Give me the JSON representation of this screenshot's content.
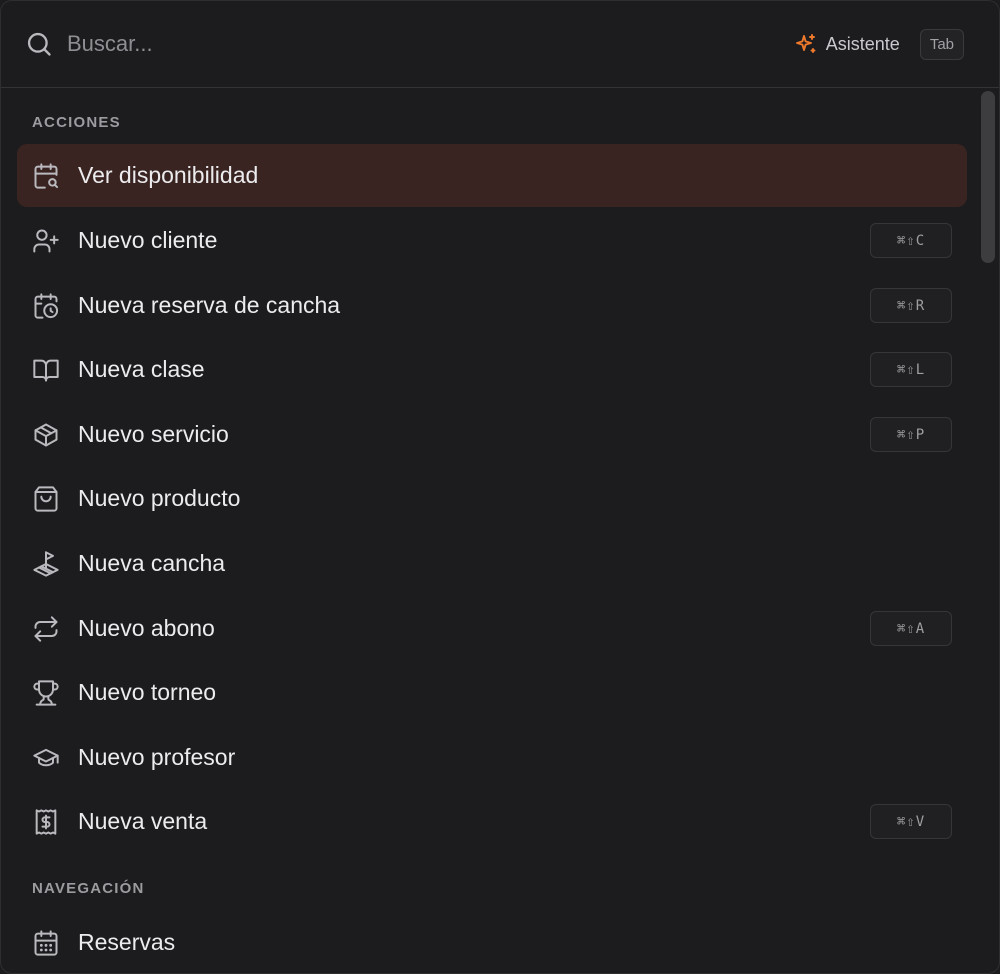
{
  "search": {
    "placeholder": "Buscar...",
    "icon": "search-icon"
  },
  "assistant": {
    "label": "Asistente",
    "icon": "sparkles-icon",
    "accent_color": "#f07a2c",
    "tab_key": "Tab"
  },
  "sections": {
    "actions_title": "ACCIONES",
    "navigation_title": "NAVEGACIÓN"
  },
  "actions": [
    {
      "label": "Ver disponibilidad",
      "icon": "calendar-search-icon",
      "shortcut": "",
      "active": true
    },
    {
      "label": "Nuevo cliente",
      "icon": "user-plus-icon",
      "shortcut": "⌘⇧C"
    },
    {
      "label": "Nueva reserva de cancha",
      "icon": "calendar-clock-icon",
      "shortcut": "⌘⇧R"
    },
    {
      "label": "Nueva clase",
      "icon": "book-open-icon",
      "shortcut": "⌘⇧L"
    },
    {
      "label": "Nuevo servicio",
      "icon": "package-icon",
      "shortcut": "⌘⇧P"
    },
    {
      "label": "Nuevo producto",
      "icon": "shopping-bag-icon",
      "shortcut": ""
    },
    {
      "label": "Nueva cancha",
      "icon": "land-plot-icon",
      "shortcut": ""
    },
    {
      "label": "Nuevo abono",
      "icon": "repeat-icon",
      "shortcut": "⌘⇧A"
    },
    {
      "label": "Nuevo torneo",
      "icon": "trophy-icon",
      "shortcut": ""
    },
    {
      "label": "Nuevo profesor",
      "icon": "graduation-cap-icon",
      "shortcut": ""
    },
    {
      "label": "Nueva venta",
      "icon": "receipt-icon",
      "shortcut": "⌘⇧V"
    }
  ],
  "navigation": [
    {
      "label": "Reservas",
      "icon": "calendar-icon"
    }
  ],
  "colors": {
    "background": "#1c1c1e",
    "active_row": "#3a2421",
    "text": "#ececee",
    "muted": "#9b9ba0"
  }
}
